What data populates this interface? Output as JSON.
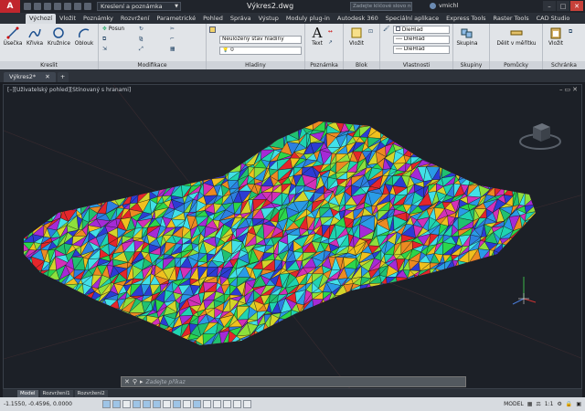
{
  "title_bar": {
    "workspace": "Kreslení a poznámka",
    "document_title": "Výkres2.dwg",
    "search_placeholder": "Zadejte klíčové slovo nebo výraz",
    "user": "vmichl",
    "logo_letter": "A"
  },
  "ribbon_tabs": [
    "Výchozí",
    "Vložit",
    "Poznámky",
    "Rozvržení",
    "Parametrické",
    "Pohled",
    "Správa",
    "Výstup",
    "Moduly plug-in",
    "Autodesk 360",
    "Speciální aplikace",
    "Express Tools",
    "Raster Tools",
    "CAD Studio"
  ],
  "ribbon": {
    "draw": {
      "title": "Kreslit",
      "line": "Úsečka",
      "polyline": "Křivka",
      "circle": "Kružnice",
      "arc": "Oblouk"
    },
    "modify": {
      "title": "Modifikace",
      "move": "Posun"
    },
    "layers": {
      "title": "Hladiny",
      "current_layer": "Neuložený stav hladiny",
      "layer_value": "0"
    },
    "annotation": {
      "title": "Poznámka",
      "text": "Text",
      "dimension": "Kóta"
    },
    "block": {
      "title": "Blok",
      "insert": "Vložit"
    },
    "properties": {
      "title": "Vlastnosti",
      "color": "DleHlad",
      "linetype": "DleHlad",
      "lineweight": "DleHlad"
    },
    "groups": {
      "title": "Skupiny",
      "group": "Skupina"
    },
    "utilities": {
      "title": "Pomůcky",
      "measure": "Dělit v měřítku"
    },
    "clipboard": {
      "title": "Schránka",
      "paste": "Vložit"
    }
  },
  "file_tabs": {
    "active": "Výkres2*"
  },
  "viewport": {
    "label": "[–][Uživatelský pohled][Stínovaný s hranami]"
  },
  "command_line": {
    "prompt": "Zadejte příkaz"
  },
  "layout_tabs": [
    "Model",
    "Rozvržení1",
    "Rozvržení2"
  ],
  "status_bar": {
    "coords": "-1.1550, -0.4596, 0.0000",
    "model_label": "MODEL",
    "scale": "1:1"
  }
}
